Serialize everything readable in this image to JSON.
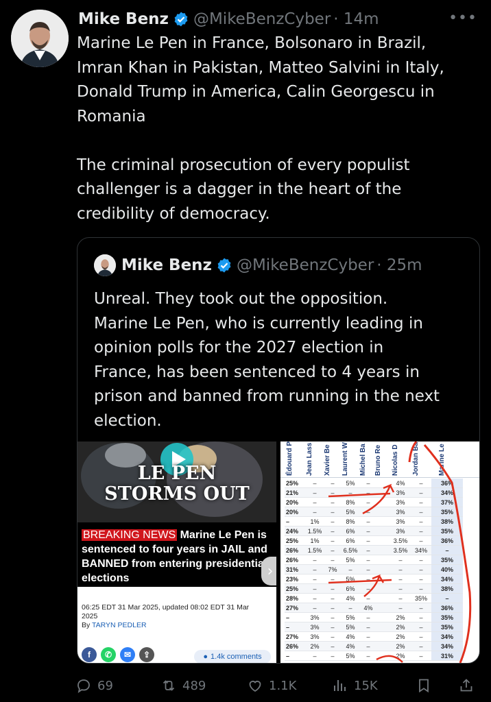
{
  "tweet": {
    "author_name": "Mike Benz",
    "handle": "@MikeBenzCyber",
    "time": "· 14m",
    "text": "Marine Le Pen in France, Bolsonaro in Brazil,\nImran Khan in Pakistan, Matteo Salvini in Italy,\nDonald Trump in America, Calin Georgescu in\nRomania\n\nThe criminal prosecution of every populist\nchallenger is a dagger in the heart of the\ncredibility of democracy."
  },
  "quote": {
    "author_name": "Mike Benz",
    "handle": "@MikeBenzCyber",
    "time": "· 25m",
    "text": "Unreal. They took out the opposition.\nMarine Le Pen, who is currently leading in\nopinion polls for the 2027 election in\nFrance, has been sentenced to 4 years in\nprison and banned from running in the next\nelection."
  },
  "media_left": {
    "video_title_line1": "LE PEN",
    "video_title_line2": "STORMS OUT",
    "breaking_label": "BREAKING NEWS",
    "headline": " Marine Le Pen is sentenced to four years in JAIL and BANNED from entering presidential elections",
    "timestamp": "06:25 EDT 31 Mar 2025, updated 08:02 EDT 31 Mar 2025",
    "byline_prefix": "By ",
    "byline_author": "TARYN PEDLER",
    "comments": "1.4k comments",
    "social_icons": [
      "facebook-icon",
      "whatsapp-icon",
      "messenger-icon",
      "share-icon"
    ]
  },
  "poll": {
    "columns": [
      "Édouard P",
      "Jean Lass",
      "Xavier Be",
      "Laurent W",
      "Michel Ba",
      "Bruno Re",
      "Nicolas D",
      "Jordan Ba",
      "Marine Le"
    ],
    "rows": [
      [
        "25%",
        "–",
        "–",
        "5%",
        "–",
        "",
        "4%",
        "–",
        "36%"
      ],
      [
        "21%",
        "–",
        "–",
        "–",
        "–",
        "",
        "3%",
        "–",
        "34%"
      ],
      [
        "20%",
        "–",
        "–",
        "8%",
        "–",
        "",
        "3%",
        "–",
        "37%"
      ],
      [
        "20%",
        "–",
        "–",
        "5%",
        "–",
        "",
        "3%",
        "–",
        "35%"
      ],
      [
        "–",
        "1%",
        "–",
        "8%",
        "–",
        "",
        "3%",
        "–",
        "38%"
      ],
      [
        "24%",
        "1.5%",
        "–",
        "6%",
        "–",
        "",
        "3%",
        "–",
        "35%"
      ],
      [
        "25%",
        "1%",
        "–",
        "6%",
        "–",
        "",
        "3.5%",
        "–",
        "36%"
      ],
      [
        "26%",
        "1.5%",
        "–",
        "6.5%",
        "–",
        "",
        "3.5%",
        "34%",
        "–"
      ],
      [
        "26%",
        "–",
        "–",
        "5%",
        "–",
        "",
        "–",
        "–",
        "35%"
      ],
      [
        "31%",
        "–",
        "7%",
        "–",
        "–",
        "",
        "–",
        "–",
        "40%"
      ],
      [
        "23%",
        "–",
        "–",
        "5%",
        "–",
        "",
        "–",
        "–",
        "34%"
      ],
      [
        "25%",
        "–",
        "–",
        "6%",
        "–",
        "",
        "–",
        "–",
        "38%"
      ],
      [
        "28%",
        "–",
        "–",
        "4%",
        "–",
        "",
        "–",
        "35%",
        "–"
      ],
      [
        "27%",
        "–",
        "–",
        "–",
        "4%",
        "",
        "–",
        "–",
        "36%"
      ],
      [
        "–",
        "3%",
        "–",
        "5%",
        "–",
        "",
        "2%",
        "–",
        "35%"
      ],
      [
        "–",
        "3%",
        "–",
        "5%",
        "–",
        "",
        "2%",
        "–",
        "35%"
      ],
      [
        "27%",
        "3%",
        "–",
        "4%",
        "–",
        "",
        "2%",
        "–",
        "34%"
      ],
      [
        "26%",
        "2%",
        "–",
        "4%",
        "–",
        "",
        "2%",
        "–",
        "34%"
      ],
      [
        "–",
        "–",
        "–",
        "5%",
        "–",
        "",
        "2%",
        "–",
        "31%"
      ]
    ]
  },
  "actions": {
    "replies": "69",
    "reposts": "489",
    "likes": "1.1K",
    "views": "15K"
  },
  "colors": {
    "background": "#000000",
    "text": "#e7e9ea",
    "muted": "#71767b",
    "verified": "#1d9bf0",
    "breaking": "#d0161c",
    "annotation": "#e0301e"
  }
}
